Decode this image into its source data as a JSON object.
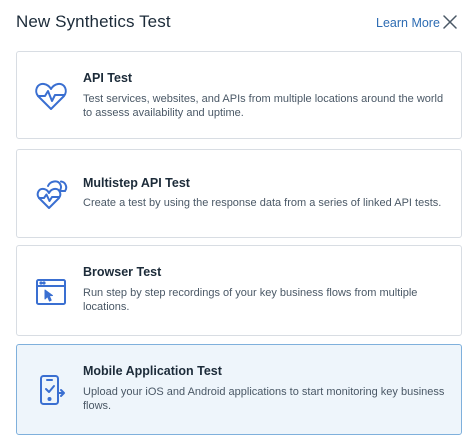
{
  "header": {
    "title": "New Synthetics Test",
    "learn_more": "Learn More"
  },
  "colors": {
    "accent": "#2d6cb3",
    "icon": "#3a6fd1",
    "selected_bg": "#eef5fb",
    "selected_border": "#7fb0dc",
    "card_border": "#d8dde3"
  },
  "options": [
    {
      "title": "API Test",
      "description": "Test services, websites, and APIs from multiple locations around the world to assess availability and uptime.",
      "icon": "heart-pulse-icon",
      "selected": false
    },
    {
      "title": "Multistep API Test",
      "description": "Create a test by using the response data from a series of linked API tests.",
      "icon": "double-heart-pulse-icon",
      "selected": false
    },
    {
      "title": "Browser Test",
      "description": "Run step by step recordings of your key business flows from multiple locations.",
      "icon": "browser-window-icon",
      "selected": false
    },
    {
      "title": "Mobile Application Test",
      "description": "Upload your iOS and Android applications to start monitoring key business flows.",
      "icon": "mobile-check-icon",
      "selected": true
    }
  ]
}
